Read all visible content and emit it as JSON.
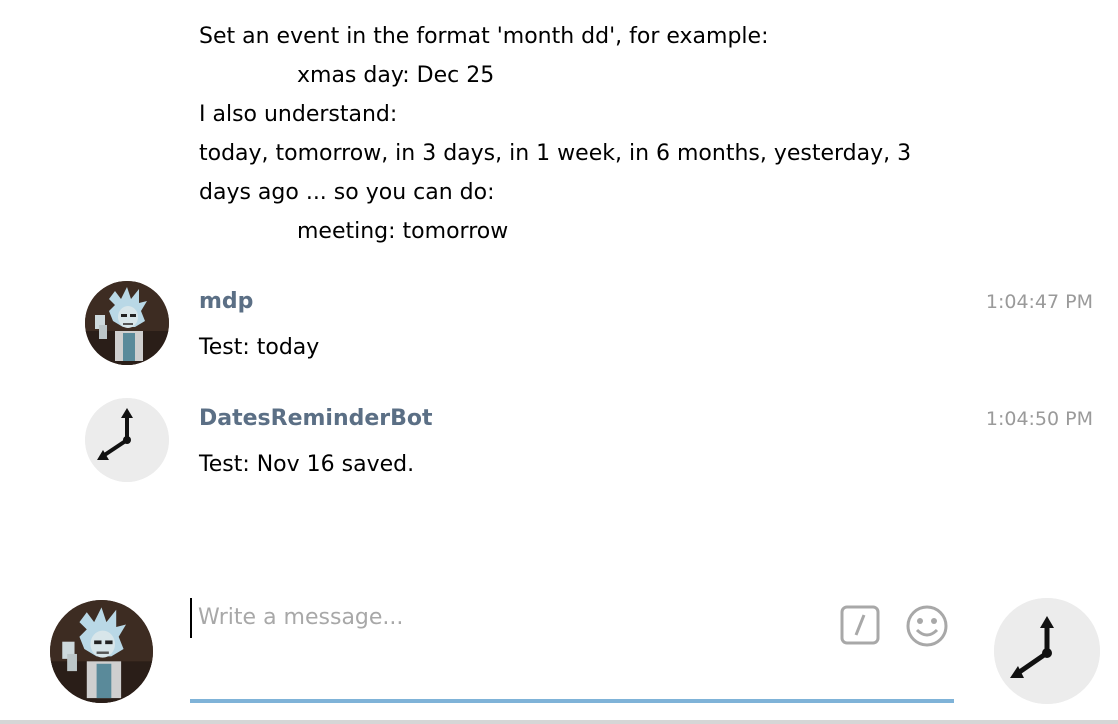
{
  "messages": {
    "bot_help": {
      "line1": "Set an event in the format 'month dd', for example:",
      "line2": "xmas day: Dec 25",
      "line3": "I also understand:",
      "line4": "today, tomorrow, in 3 days, in 1 week, in 6 months, yesterday, 3",
      "line5": "days ago ... so you can do:",
      "line6": "meeting: tomorrow"
    },
    "user_msg": {
      "sender": "mdp",
      "time": "1:04:47 PM",
      "text": "Test: today"
    },
    "bot_msg": {
      "sender": "DatesReminderBot",
      "time": "1:04:50 PM",
      "text": "Test: Nov 16 saved."
    }
  },
  "composer": {
    "placeholder": "Write a message...",
    "value": ""
  },
  "icons": {
    "commands": "slash-command-icon",
    "emoji": "smiley-icon",
    "send": "clock-bot-icon"
  },
  "colors": {
    "sender": "#5b6f85",
    "time": "#9a9a9a",
    "accent_underline": "#7fb3d8",
    "placeholder": "#a8a8a8"
  }
}
